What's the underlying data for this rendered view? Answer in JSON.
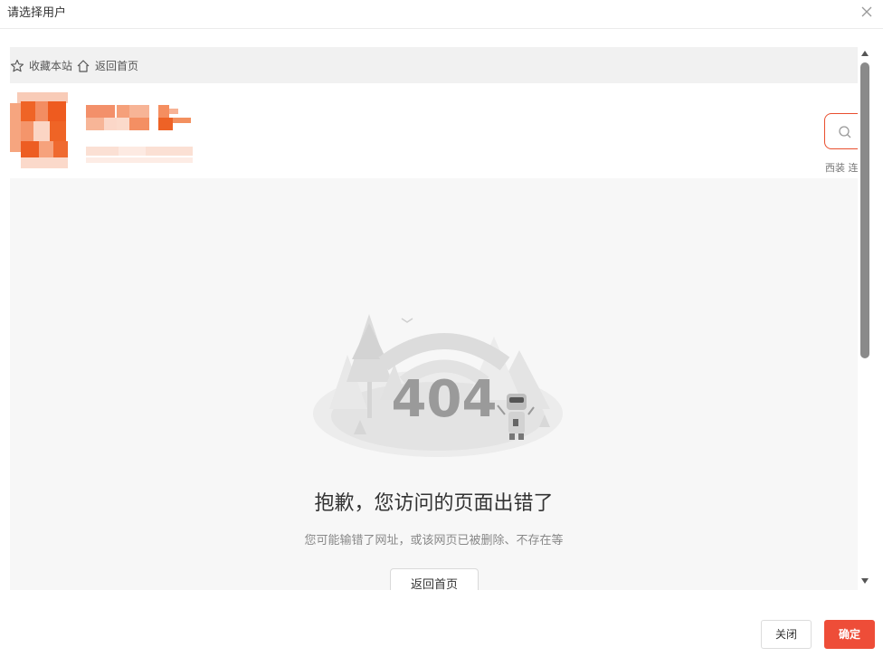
{
  "dialog": {
    "title": "请选择用户",
    "close_icon": "close-icon"
  },
  "site": {
    "topbar": {
      "favorite_label": "收藏本站",
      "favorite_icon": "star-icon",
      "home_label": "返回首页",
      "home_icon": "home-icon"
    },
    "search": {
      "icon": "search-icon",
      "hot_words": "西装 连"
    },
    "error": {
      "code": "404",
      "title": "抱歉，您访问的页面出错了",
      "description": "您可能输错了网址，或该网页已被删除、不存在等",
      "home_button": "返回首页"
    }
  },
  "footer": {
    "close_label": "关闭",
    "ok_label": "确定"
  },
  "colors": {
    "accent": "#ee4d38",
    "brand_orange": "#f26522"
  }
}
